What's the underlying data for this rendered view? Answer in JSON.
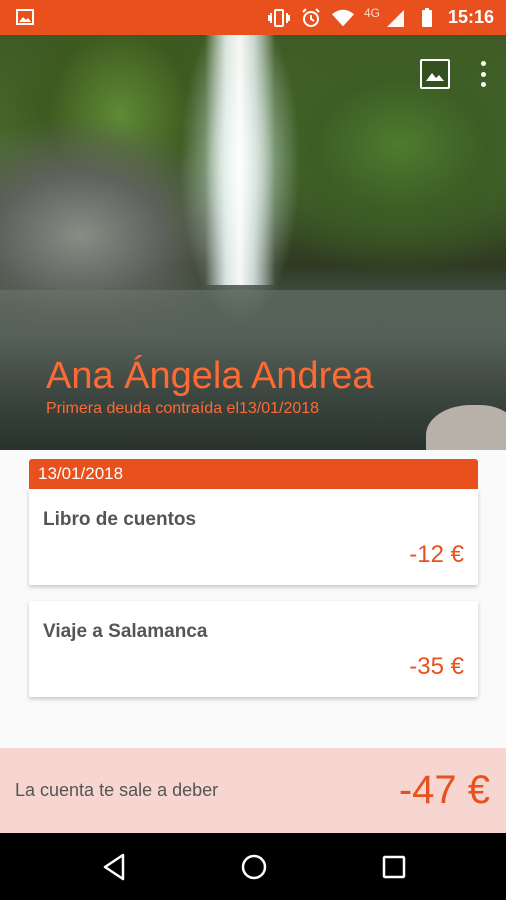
{
  "status_bar": {
    "network": "4G",
    "time": "15:16",
    "icons": [
      "image-icon",
      "vibrate-icon",
      "alarm-icon",
      "wifi-icon",
      "signal-icon",
      "battery-icon"
    ]
  },
  "hero": {
    "person_name": "Ana Ángela Andrea",
    "subtitle": "Primera deuda contraída el13/01/2018",
    "actions": [
      "change-image-icon",
      "more-options-icon"
    ]
  },
  "debts": {
    "date": "13/01/2018",
    "entries": [
      {
        "title": "Libro de cuentos",
        "amount": "-12 €"
      },
      {
        "title": "Viaje a Salamanca",
        "amount": "-35 €"
      }
    ]
  },
  "summary": {
    "label": "La cuenta te sale a deber",
    "total": "-47 €"
  },
  "colors": {
    "accent": "#e8501e",
    "name_text": "#ff6a33",
    "summary_bg": "#f7d5d0",
    "card_bg": "#ffffff"
  },
  "nav": [
    "back-icon",
    "home-icon",
    "recents-icon"
  ]
}
